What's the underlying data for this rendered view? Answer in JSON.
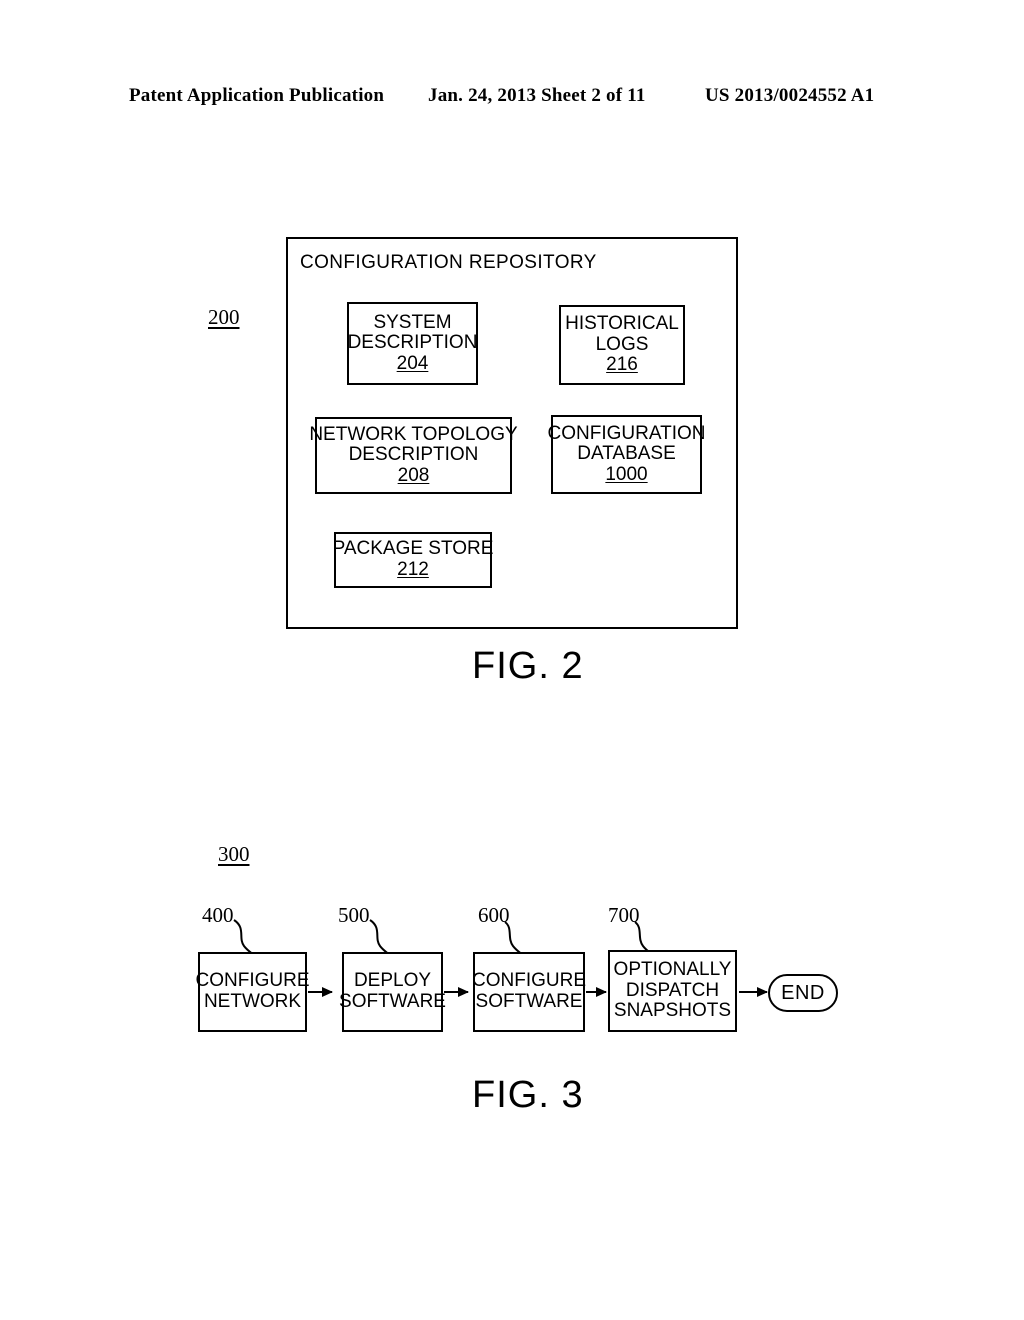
{
  "header": {
    "publication": "Patent Application Publication",
    "date_sheet": "Jan. 24, 2013  Sheet 2 of 11",
    "document_number": "US 2013/0024552 A1"
  },
  "figure2": {
    "caption": "FIG. 2",
    "reference_numeral": "200",
    "container_title": "CONFIGURATION REPOSITORY",
    "boxes": [
      {
        "lines": [
          "SYSTEM",
          "DESCRIPTION"
        ],
        "reference_numeral": "204"
      },
      {
        "lines": [
          "HISTORICAL",
          "LOGS"
        ],
        "reference_numeral": "216"
      },
      {
        "lines": [
          "NETWORK TOPOLOGY",
          "DESCRIPTION"
        ],
        "reference_numeral": "208"
      },
      {
        "lines": [
          "CONFIGURATION",
          "DATABASE"
        ],
        "reference_numeral": "1000"
      },
      {
        "lines": [
          "PACKAGE STORE"
        ],
        "reference_numeral": "212"
      }
    ]
  },
  "figure3": {
    "caption": "FIG. 3",
    "reference_numeral": "300",
    "steps": [
      {
        "lines": [
          "CONFIGURE",
          "NETWORK"
        ],
        "reference_numeral": "400"
      },
      {
        "lines": [
          "DEPLOY",
          "SOFTWARE"
        ],
        "reference_numeral": "500"
      },
      {
        "lines": [
          "CONFIGURE",
          "SOFTWARE"
        ],
        "reference_numeral": "600"
      },
      {
        "lines": [
          "OPTIONALLY",
          "DISPATCH",
          "SNAPSHOTS"
        ],
        "reference_numeral": "700"
      }
    ],
    "terminator": "END"
  },
  "colors": {
    "ink": "#000000",
    "paper": "#ffffff"
  }
}
